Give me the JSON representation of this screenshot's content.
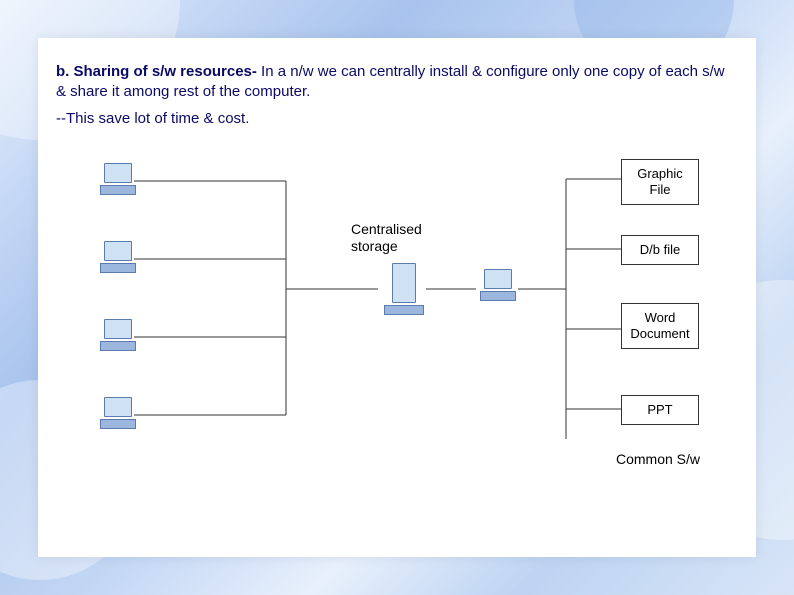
{
  "heading": {
    "bold": "b. Sharing of s/w resources-",
    "rest": " In a n/w we can centrally install & configure only one copy of each s/w & share it among rest of the computer.",
    "line2": "--This save lot of time & cost."
  },
  "labels": {
    "central": "Centralised storage",
    "common": "Common S/w"
  },
  "files": {
    "graphic": "Graphic File",
    "db": "D/b file",
    "word": "Word Document",
    "ppt": "PPT"
  }
}
